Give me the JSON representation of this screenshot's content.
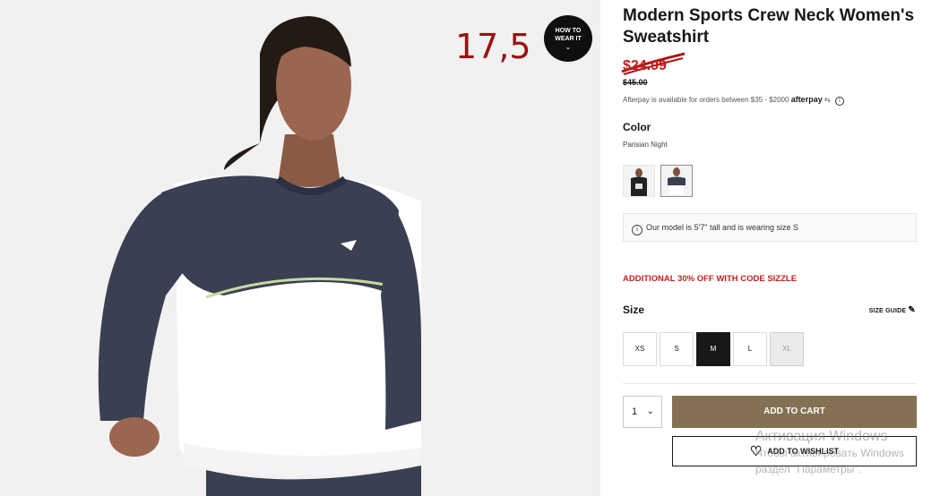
{
  "gallery": {
    "handwritten_price": "17,5",
    "how_to_wear": {
      "line1": "HOW TO",
      "line2": "WEAR IT"
    }
  },
  "product": {
    "title": "Modern Sports Crew Neck Women's Sweatshirt",
    "sale_price": "$24.99",
    "original_price": "$45.00",
    "afterpay_text": "Afterpay is available for orders between $35 - $2000",
    "afterpay_logo": "afterpay",
    "color_label": "Color",
    "color_name": "Parisian Night",
    "model_note": "Our model is 5'7\" tall and is wearing size S",
    "promo": "ADDITIONAL 30% OFF WITH CODE SIZZLE",
    "size_label": "Size",
    "size_guide": "SIZE GUIDE",
    "sizes": [
      {
        "label": "XS",
        "state": "available"
      },
      {
        "label": "S",
        "state": "available"
      },
      {
        "label": "M",
        "state": "selected"
      },
      {
        "label": "L",
        "state": "available"
      },
      {
        "label": "XL",
        "state": "unavailable"
      }
    ],
    "quantity": "1",
    "add_to_cart": "ADD TO CART",
    "add_to_wishlist": "ADD TO WISHLIST"
  },
  "watermark": {
    "line1": "Активация Windows",
    "line2": "Чтобы активировать Windows",
    "line3": "раздел \"Параметры\"."
  },
  "colors": {
    "sale_red": "#c21f1f",
    "cart_gold": "#847052",
    "sweatshirt_navy": "#3a3f52",
    "annotation_red": "#9b1111"
  }
}
